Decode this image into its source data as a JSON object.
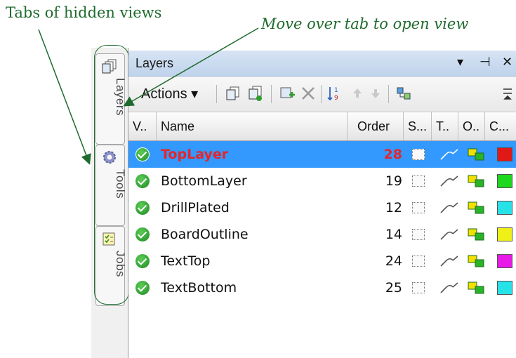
{
  "annotations": {
    "left": "Tabs of hidden views",
    "right": "Move over tab to open view"
  },
  "side_tabs": [
    {
      "label": "Layers",
      "icon": "layers-icon"
    },
    {
      "label": "Tools",
      "icon": "gear-icon"
    },
    {
      "label": "Jobs",
      "icon": "checklist-icon"
    }
  ],
  "panel": {
    "title": "Layers",
    "title_buttons": {
      "dropdown": "▾",
      "pin": "⊣",
      "close": "✕"
    },
    "toolbar": {
      "actions_label": "Actions ▾"
    },
    "columns": {
      "visible": "V..",
      "name": "Name",
      "order": "Order",
      "s": "S...",
      "t": "T..",
      "o": "O..",
      "c": "C..."
    },
    "rows": [
      {
        "name": "TopLayer",
        "order": "28",
        "selected": true,
        "color": "#e01818"
      },
      {
        "name": "BottomLayer",
        "order": "19",
        "selected": false,
        "color": "#1ed81e"
      },
      {
        "name": "DrillPlated",
        "order": "12",
        "selected": false,
        "color": "#27e3e8"
      },
      {
        "name": "BoardOutline",
        "order": "14",
        "selected": false,
        "color": "#f0f019"
      },
      {
        "name": "TextTop",
        "order": "24",
        "selected": false,
        "color": "#e71ae7"
      },
      {
        "name": "TextBottom",
        "order": "25",
        "selected": false,
        "color": "#27e3e8"
      }
    ]
  }
}
